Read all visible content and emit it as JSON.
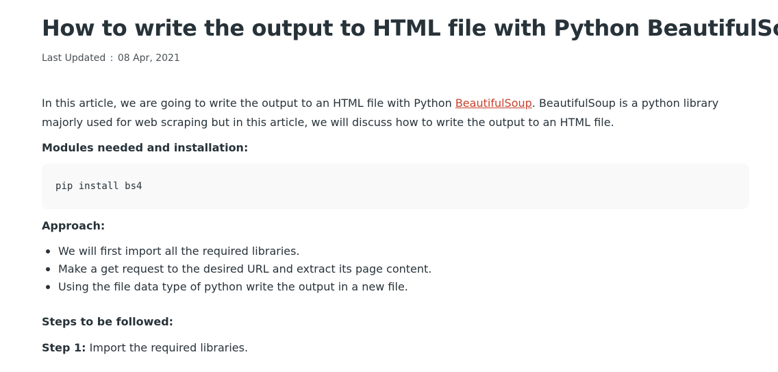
{
  "article": {
    "title": "How to write the output to HTML file with Python BeautifulSoup?",
    "last_updated_label": "Last Updated",
    "last_updated_separator": ":",
    "last_updated_date": "08 Apr, 2021",
    "intro": {
      "text_before_link": "In this article, we are going to write the output to an HTML file with Python ",
      "link_text": "BeautifulSoup",
      "text_after_link": ".  BeautifulSoup is a python library majorly used for web scraping but in this article, we will discuss how to write the output to an HTML file."
    },
    "modules_heading": "Modules needed and installation:",
    "code": "pip install bs4",
    "approach_heading": "Approach:",
    "approach_items": [
      "We will first import all the required libraries.",
      "Make a get request to the desired URL and extract its page content.",
      "Using the file data type of python write the output in a new file."
    ],
    "steps_heading": "Steps to be followed:",
    "step1": {
      "label": "Step 1:",
      "text": " Import the required libraries."
    }
  },
  "colors": {
    "text": "#273239",
    "link": "#c7402b",
    "code_background": "#f9f9f9",
    "meta_text": "#4a5156"
  }
}
